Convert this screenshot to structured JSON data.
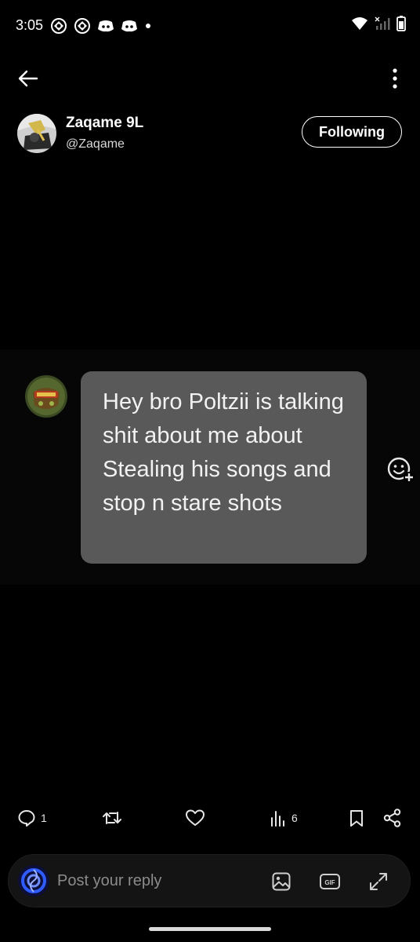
{
  "status_bar": {
    "time": "3:05",
    "left_icons": [
      "app-icon",
      "app-icon",
      "discord-icon",
      "discord-icon",
      "dot-icon"
    ],
    "right_icons": [
      "wifi-icon",
      "signal-icon",
      "battery-icon"
    ]
  },
  "header": {
    "display_name": "Zaqame 9L",
    "handle": "@Zaqame",
    "follow_label": "Following"
  },
  "message": {
    "text": "Hey bro Poltzii is talking shit about me about Stealing his songs and stop n stare shots"
  },
  "actions": {
    "reply_count": "1",
    "views_count": "6"
  },
  "reply_bar": {
    "placeholder": "Post your reply"
  },
  "colors": {
    "background": "#000000",
    "bubble": "#595959",
    "reply_bar": "#141414"
  }
}
